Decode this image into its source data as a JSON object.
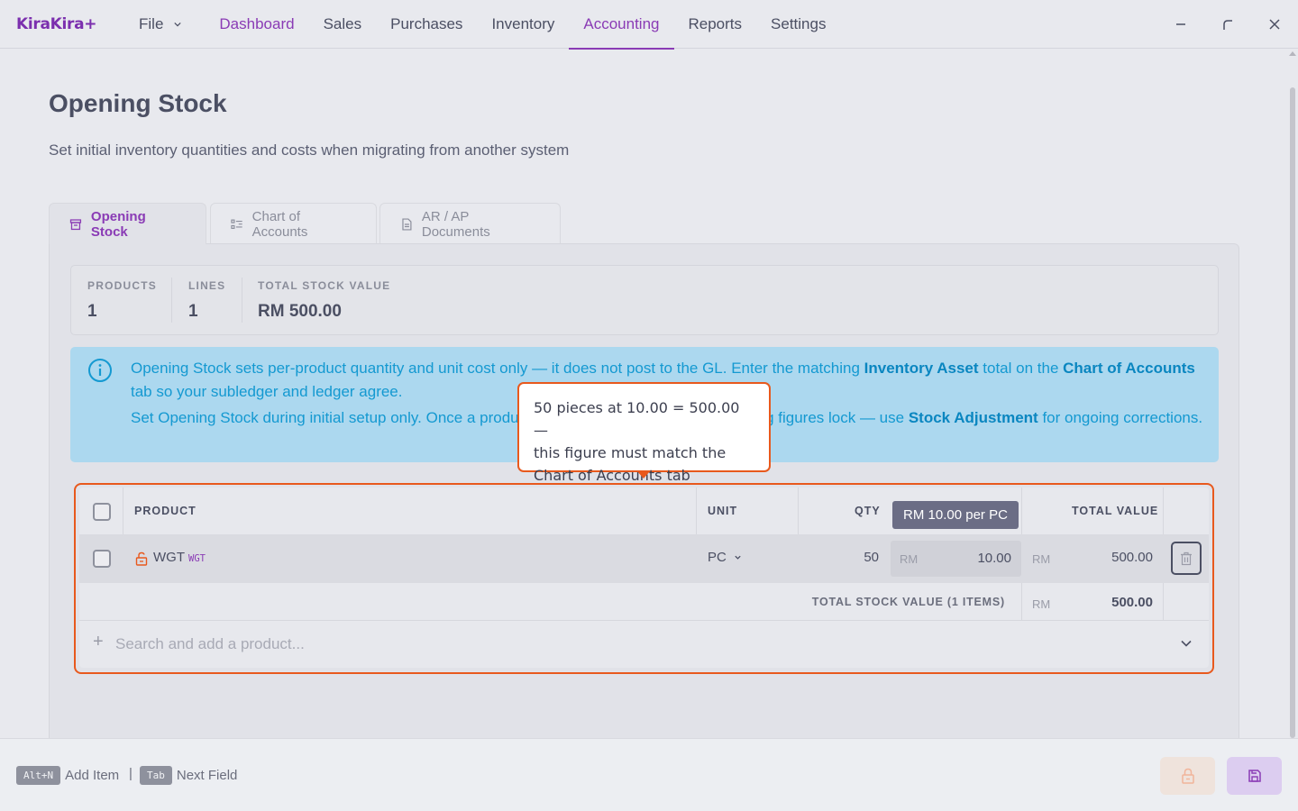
{
  "app": {
    "logo": "KiraKira+"
  },
  "nav": {
    "file": "File",
    "items": [
      {
        "label": "Dashboard",
        "color": "#8a3bb5"
      },
      {
        "label": "Sales"
      },
      {
        "label": "Purchases"
      },
      {
        "label": "Inventory"
      },
      {
        "label": "Accounting",
        "active": true
      },
      {
        "label": "Reports"
      },
      {
        "label": "Settings"
      }
    ]
  },
  "page": {
    "title": "Opening Stock",
    "subtitle": "Set initial inventory quantities and costs when migrating from another system"
  },
  "tabs": [
    {
      "label": "Opening Stock",
      "icon": "archive-icon",
      "active": true
    },
    {
      "label": "Chart of Accounts",
      "icon": "list-icon"
    },
    {
      "label": "AR / AP Documents",
      "icon": "document-icon"
    }
  ],
  "stats": [
    {
      "label": "PRODUCTS",
      "value": "1"
    },
    {
      "label": "LINES",
      "value": "1"
    },
    {
      "label": "TOTAL STOCK VALUE",
      "value": "RM 500.00"
    }
  ],
  "info": {
    "p1_a": "Opening Stock sets per-product quantity and unit cost only — it does not post to the GL. Enter the matching ",
    "p1_b": "Inventory Asset",
    "p1_c": " total on the ",
    "p1_d": "Chart of Accounts",
    "p1_e": " tab so your subledger and ledger agree.",
    "p2_a": "Set Opening Stock during initial setup only. Once a produ",
    "p2_b": "ng figures lock — use ",
    "p2_c": "Stock Adjustment",
    "p2_d": " for ongoing corrections."
  },
  "table": {
    "headers": {
      "product": "PRODUCT",
      "unit": "UNIT",
      "qty": "QTY",
      "total": "TOTAL VALUE"
    },
    "cost_tooltip": "RM 10.00 per PC",
    "rows": [
      {
        "name": "WGT",
        "code": "WGT",
        "unit": "PC",
        "qty": "50",
        "currency": "RM",
        "unit_cost": "10.00",
        "total": "500.00"
      }
    ],
    "footer": {
      "label": "TOTAL STOCK VALUE (1 ITEMS)",
      "currency": "RM",
      "total": "500.00"
    },
    "add_placeholder": "Search and add a product..."
  },
  "callout": {
    "line1": "50 pieces at 10.00 = 500.00 —",
    "line2": "this figure must match the",
    "line3": "Chart of Accounts tab"
  },
  "footer": {
    "hint1_key": "Alt+N",
    "hint1_label": "Add Item",
    "separator": "|",
    "hint2_key": "Tab",
    "hint2_label": "Next Field"
  },
  "colors": {
    "accent": "#8a3bb5",
    "callout_border": "#e8591d",
    "info_bg": "#acd8ef",
    "info_text": "#1499d1"
  }
}
